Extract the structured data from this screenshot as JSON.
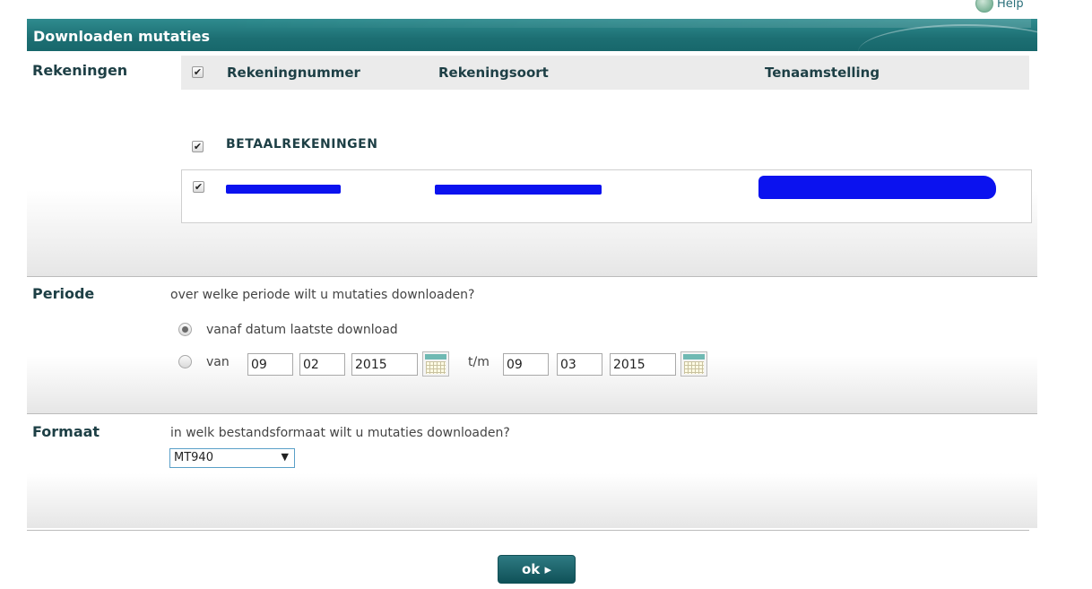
{
  "help": {
    "label": "Help"
  },
  "title": "Downloaden mutaties",
  "rekeningen": {
    "label": "Rekeningen",
    "columns": [
      "Rekeningnummer",
      "Rekeningsoort",
      "Tenaamstelling"
    ],
    "select_all_checked": true,
    "group": {
      "label": "BETAALREKENINGEN",
      "checked": true
    },
    "account": {
      "checked": true,
      "number": "",
      "type": "",
      "holder": ""
    }
  },
  "periode": {
    "label": "Periode",
    "hint": "over welke periode wilt u mutaties downloaden?",
    "option_last": "vanaf datum laatste download",
    "option_range": "van",
    "selected_option": "last",
    "separator": "t/m",
    "from": {
      "day": "09",
      "month": "02",
      "year": "2015"
    },
    "to": {
      "day": "09",
      "month": "03",
      "year": "2015"
    }
  },
  "formaat": {
    "label": "Formaat",
    "hint": "in welk bestandsformaat wilt u mutaties downloaden?",
    "selected": "MT940"
  },
  "ok_button": "ok ▸",
  "colors": {
    "brand": "#1d6f73",
    "redaction": "#0b12ef",
    "button": "#0f5158"
  }
}
